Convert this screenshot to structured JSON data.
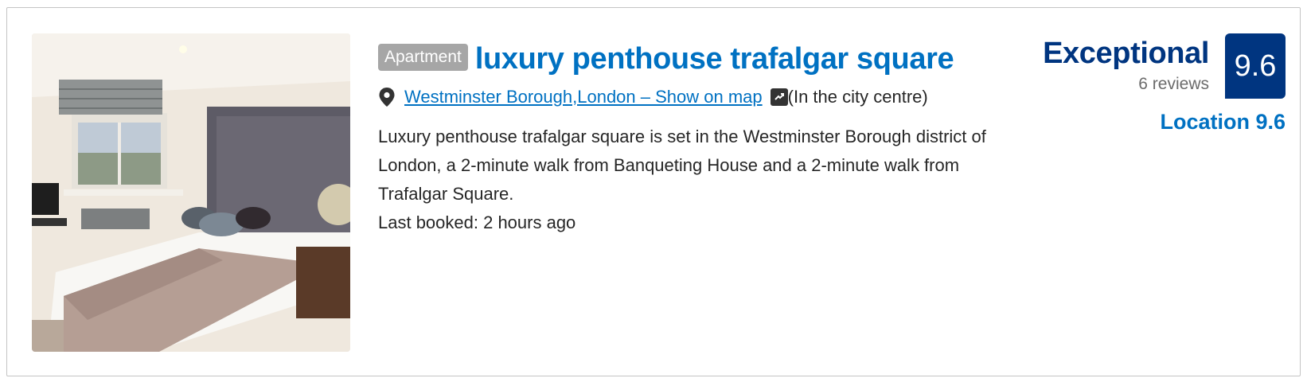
{
  "listing": {
    "type_badge": "Apartment",
    "title": "luxury penthouse trafalgar square",
    "location_link": "Westminster Borough,London – Show on map",
    "location_note": "(In the city centre)",
    "description": "Luxury penthouse trafalgar square is set in the Westminster Borough district of London, a 2-minute walk from Banqueting House and a 2-minute walk from Trafalgar Square.",
    "last_booked": "Last booked: 2 hours ago",
    "icons": {
      "pin": "map-pin-icon",
      "centre": "city-centre-icon"
    }
  },
  "rating": {
    "verdict": "Exceptional",
    "reviews": "6 reviews",
    "score": "9.6",
    "location_score": "Location 9.6"
  },
  "colors": {
    "link_blue": "#0071c2",
    "score_navy": "#003580",
    "badge_gray": "#a6a6a6"
  }
}
